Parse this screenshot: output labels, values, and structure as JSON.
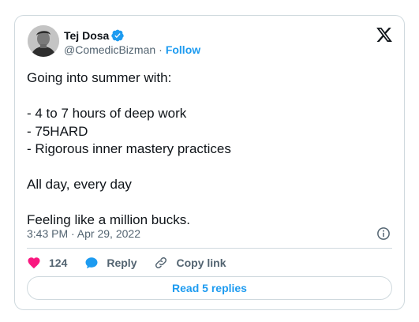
{
  "author": {
    "name": "Tej Dosa",
    "handle": "@ComedicBizman",
    "separator": "·",
    "follow_label": "Follow",
    "verified_color": "#1d9bf0"
  },
  "tweet": {
    "lines": [
      "Going into summer with:",
      "",
      "- 4 to 7 hours of deep work",
      "- 75HARD",
      "- Rigorous inner mastery practices",
      "",
      "All day, every day",
      "",
      "Feeling like a million bucks."
    ],
    "timestamp": "3:43 PM · Apr 29, 2022"
  },
  "actions": {
    "like_count": "124",
    "reply_label": "Reply",
    "copy_link_label": "Copy link",
    "like_color": "#f91880",
    "reply_color": "#1d9bf0"
  },
  "read_replies_label": "Read 5 replies",
  "icons": {
    "logo": "x-logo-icon",
    "verified": "verified-badge-icon",
    "info": "info-icon",
    "like": "heart-icon",
    "reply": "speech-bubble-icon",
    "copy": "link-icon"
  }
}
